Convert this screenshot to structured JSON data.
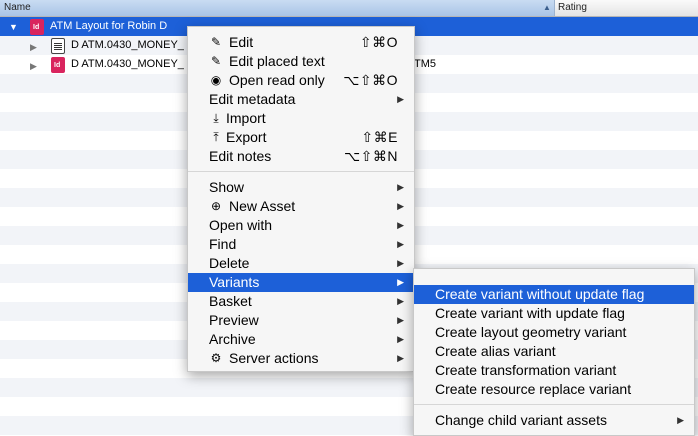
{
  "header": {
    "name": "Name",
    "rating": "Rating",
    "sort_icon": "sort-ascending-icon"
  },
  "tree": {
    "root": {
      "label": "ATM Layout for Robin D",
      "icon": "indesign-file-icon"
    },
    "children": [
      {
        "label": "D ATM.0430_MONEY_",
        "icon": "text-document-icon"
      },
      {
        "label": "D ATM.0430_MONEY_",
        "icon": "indesign-file-icon",
        "trailing": "TM5"
      }
    ]
  },
  "menu": {
    "group1": [
      {
        "icon": "pencil-icon",
        "label": "Edit",
        "shortcut": "⇧⌘O"
      },
      {
        "icon": "pencil-icon",
        "label": "Edit placed text",
        "shortcut": ""
      },
      {
        "icon": "eye-icon",
        "label": "Open read only",
        "shortcut": "⌥⇧⌘O"
      },
      {
        "icon": "",
        "label": "Edit metadata",
        "shortcut": "",
        "submenu": true
      },
      {
        "icon": "import-icon",
        "label": "Import",
        "shortcut": ""
      },
      {
        "icon": "export-icon",
        "label": "Export",
        "shortcut": "⇧⌘E"
      },
      {
        "icon": "",
        "label": "Edit notes",
        "shortcut": "⌥⇧⌘N"
      }
    ],
    "group2": [
      {
        "icon": "",
        "label": "Show",
        "submenu": true
      },
      {
        "icon": "plus-circle-icon",
        "label": "New Asset",
        "submenu": true
      },
      {
        "icon": "",
        "label": "Open with",
        "submenu": true
      },
      {
        "icon": "",
        "label": "Find",
        "submenu": true
      },
      {
        "icon": "",
        "label": "Delete",
        "submenu": true
      },
      {
        "icon": "",
        "label": "Variants",
        "submenu": true,
        "highlighted": true
      },
      {
        "icon": "",
        "label": "Basket",
        "submenu": true
      },
      {
        "icon": "",
        "label": "Preview",
        "submenu": true
      },
      {
        "icon": "",
        "label": "Archive",
        "submenu": true
      },
      {
        "icon": "gear-icon",
        "label": "Server actions",
        "submenu": true
      }
    ]
  },
  "submenu": {
    "items": [
      {
        "label": "Create variant without update flag",
        "highlighted": true
      },
      {
        "label": "Create variant with update flag"
      },
      {
        "label": "Create layout geometry variant"
      },
      {
        "label": "Create alias variant"
      },
      {
        "label": "Create transformation variant"
      },
      {
        "label": "Create resource replace variant"
      }
    ],
    "footer": {
      "label": "Change child variant assets",
      "submenu": true
    }
  },
  "colors": {
    "selection": "#1d60d8",
    "menu_bg": "#f6f6f6",
    "header_selected": "#b6cde9"
  }
}
